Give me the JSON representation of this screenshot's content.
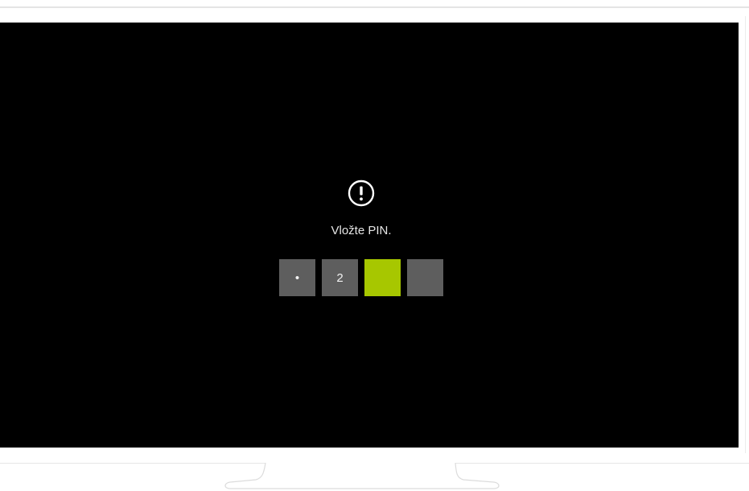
{
  "screen": {
    "message": "Vložte PIN.",
    "icon": "exclamation-circle-icon",
    "pin_boxes": [
      {
        "value": "•",
        "state": "filled"
      },
      {
        "value": "2",
        "state": "filled"
      },
      {
        "value": "",
        "state": "active"
      },
      {
        "value": "",
        "state": "empty"
      }
    ]
  },
  "colors": {
    "screen_background": "#000000",
    "pin_box": "#5e5e5e",
    "pin_box_active": "#a7c700",
    "text": "#e6e6e6"
  }
}
